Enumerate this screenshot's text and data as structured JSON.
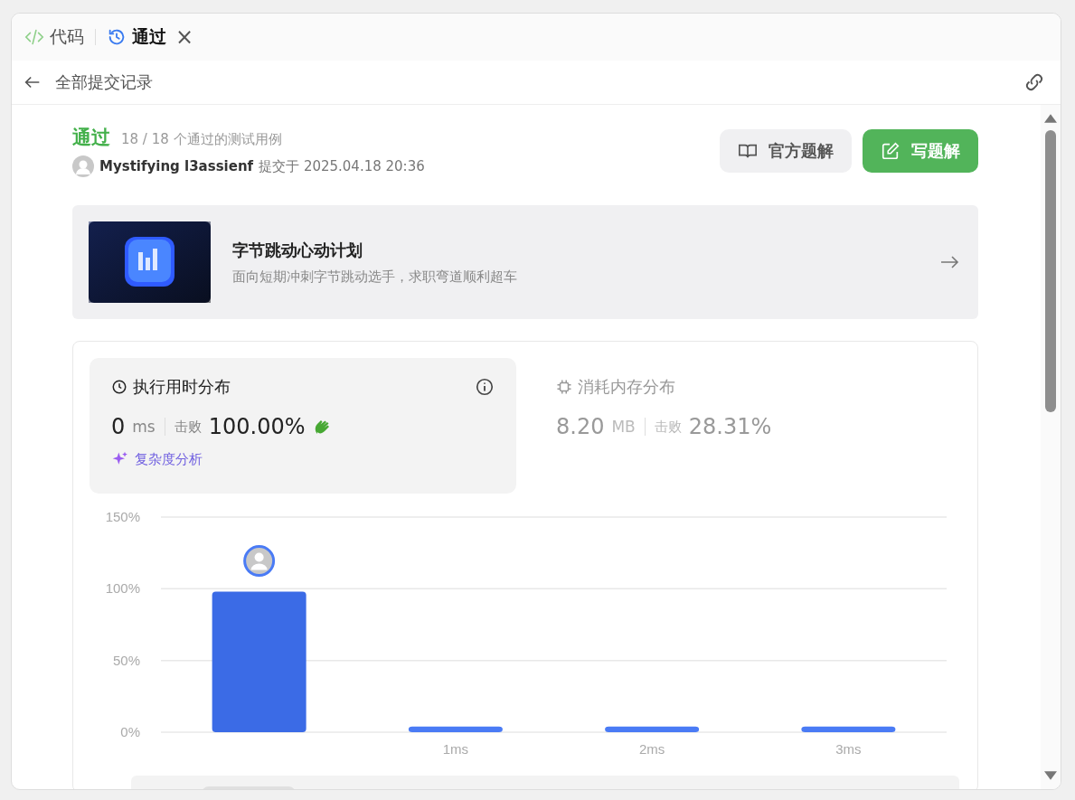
{
  "tabs": [
    {
      "label": "代码",
      "kind": "code",
      "selected": false,
      "closable": false
    },
    {
      "label": "通过",
      "kind": "history",
      "selected": true,
      "closable": true
    }
  ],
  "close_tab": "×",
  "header": {
    "back_label": "全部提交记录"
  },
  "result": {
    "status": "通过",
    "cases": "18 / 18 个通过的测试用例",
    "user": "Mystifying l3assienf",
    "submitted": "提交于 2025.04.18 20:36"
  },
  "buttons": [
    {
      "label": "官方题解",
      "kind": "book",
      "primary": false
    },
    {
      "label": "写题解",
      "kind": "edit",
      "primary": true
    }
  ],
  "promo": {
    "title": "字节跳动心动计划",
    "subtitle": "面向短期冲刺字节跳动选手，求职弯道顺利超车"
  },
  "stats": [
    {
      "title": "执行用时分布",
      "kind": "time",
      "selected": true,
      "value": "0",
      "unit": "ms",
      "beats_label": "击败",
      "beats": "100.00%",
      "analysis": "复杂度分析"
    },
    {
      "title": "消耗内存分布",
      "kind": "memory",
      "selected": false,
      "value": "8.20",
      "unit": "MB",
      "beats_label": "击败",
      "beats": "28.31%"
    }
  ],
  "chart_data": {
    "type": "bar",
    "categories": [
      null,
      "1ms",
      "2ms",
      "3ms"
    ],
    "values": [
      98,
      4,
      4,
      4
    ],
    "ylim": [
      0,
      150
    ],
    "yticks": [
      {
        "value": 0,
        "label": "0%"
      },
      {
        "value": 50,
        "label": "50%"
      },
      {
        "value": 100,
        "label": "100%"
      },
      {
        "value": 150,
        "label": "150%"
      }
    ]
  }
}
